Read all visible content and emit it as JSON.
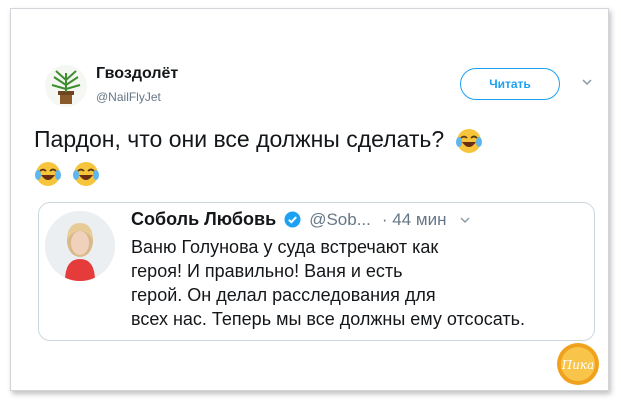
{
  "tweet": {
    "author_name": "Гвоздолёт",
    "author_handle": "@NailFlyJet",
    "follow_label": "Читать",
    "text": "Пардон, что они все должны сделать?"
  },
  "quote": {
    "author_name": "Соболь Любовь",
    "author_handle": "@Sob...",
    "time": "· 44 мин",
    "lines": [
      "Ваню Голунова у суда встречают как",
      "героя! И правильно! Ваня и есть",
      "герой. Он делал расследования для",
      "всех нас. Теперь мы все должны ему отсосать."
    ]
  },
  "watermark": {
    "text": "Пика"
  },
  "colors": {
    "accent": "#1da1f2",
    "text": "#14171a",
    "muted": "#657786",
    "border": "#ccd6dd"
  }
}
